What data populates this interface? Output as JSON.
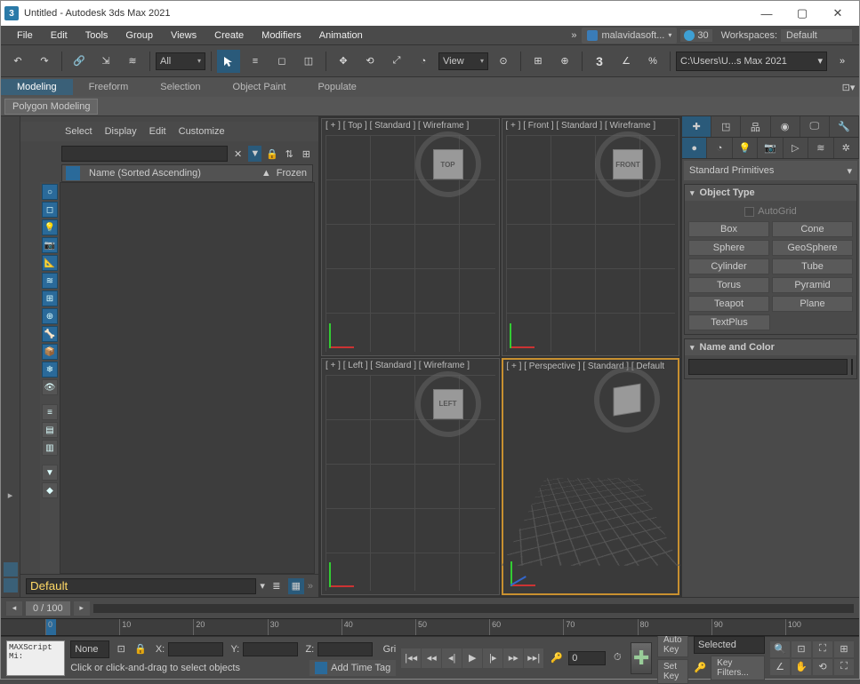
{
  "window": {
    "title": "Untitled - Autodesk 3ds Max 2021",
    "app_icon_text": "3"
  },
  "menu": {
    "items": [
      "File",
      "Edit",
      "Tools",
      "Group",
      "Views",
      "Create",
      "Modifiers",
      "Animation"
    ],
    "user": "malavidasoft...",
    "time": "30",
    "workspace_label": "Workspaces:",
    "workspace_value": "Default"
  },
  "toolbar": {
    "selection_filter": "All",
    "view_label": "View",
    "path_field": "C:\\Users\\U...s Max 2021"
  },
  "ribbon": {
    "tabs": [
      "Modeling",
      "Freeform",
      "Selection",
      "Object Paint",
      "Populate"
    ],
    "sub": "Polygon Modeling"
  },
  "scene_explorer": {
    "menus": [
      "Select",
      "Display",
      "Edit",
      "Customize"
    ],
    "col_name": "Name (Sorted Ascending)",
    "col_frozen": "Frozen",
    "layer_value": "Default"
  },
  "viewports": {
    "top": "[ + ] [ Top ] [ Standard ] [ Wireframe ]",
    "front": "[ + ] [ Front ] [ Standard ] [ Wireframe ]",
    "left": "[ + ] [ Left ] [ Standard ] [ Wireframe ]",
    "persp": "[ + ] [ Perspective ] [ Standard ] [ Default",
    "cube_top": "TOP",
    "cube_front": "FRONT",
    "cube_left": "LEFT"
  },
  "command_panel": {
    "category": "Standard Primitives",
    "object_type_label": "Object Type",
    "autogrid": "AutoGrid",
    "buttons": [
      [
        "Box",
        "Cone"
      ],
      [
        "Sphere",
        "GeoSphere"
      ],
      [
        "Cylinder",
        "Tube"
      ],
      [
        "Torus",
        "Pyramid"
      ],
      [
        "Teapot",
        "Plane"
      ],
      [
        "TextPlus",
        ""
      ]
    ],
    "name_color_label": "Name and Color"
  },
  "timeline": {
    "position": "0 / 100",
    "ticks": [
      "0",
      "10",
      "20",
      "30",
      "40",
      "50",
      "60",
      "70",
      "80",
      "90",
      "100"
    ]
  },
  "status": {
    "maxscript": "MAXScript Mi:",
    "none": "None",
    "x": "X:",
    "y": "Y:",
    "z": "Z:",
    "grid": "Gri",
    "add_time_tag": "Add Time Tag",
    "frame": "0",
    "auto_key": "Auto Key",
    "set_key": "Set Key",
    "selected": "Selected",
    "key_filters": "Key Filters...",
    "prompt": "Click or click-and-drag to select objects"
  }
}
